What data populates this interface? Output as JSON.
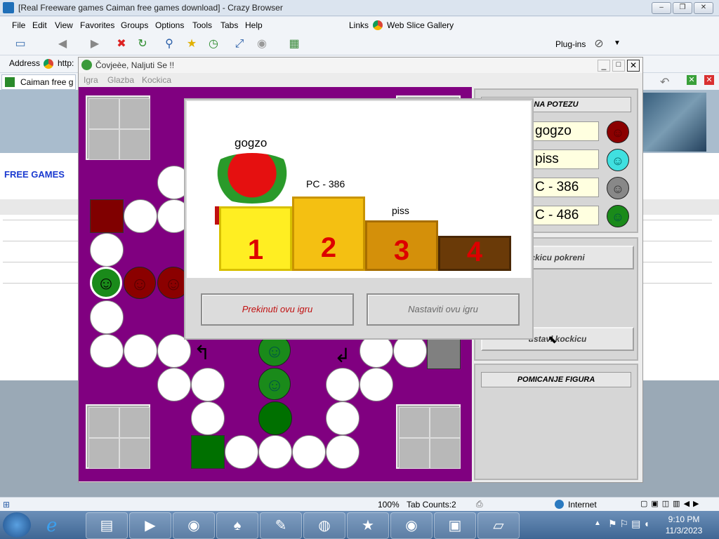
{
  "browser": {
    "title": "[Real Freeware games Caiman free games download] - Crazy Browser",
    "menu": [
      "File",
      "Edit",
      "View",
      "Favorites",
      "Groups",
      "Options",
      "Tools",
      "Tabs",
      "Help"
    ],
    "links_label": "Links",
    "web_slice": "Web Slice Gallery",
    "plugins": "Plug-ins",
    "address_label": "Address",
    "address_value": "http:",
    "tab_label": "Caiman free g",
    "page_nav": "FREE GAMES"
  },
  "status": {
    "zoom": "100%",
    "tab_counts": "Tab Counts:2",
    "zone": "Internet"
  },
  "clock": {
    "time": "9:10 PM",
    "date": "11/3/2023"
  },
  "game": {
    "title": "Čovjeèe, Naljuti Se !!",
    "menu": [
      "Igra",
      "Glazba",
      "Kockica"
    ],
    "panel_title": "NA POTEZU",
    "players": [
      {
        "name": "gogzo",
        "color": "#8b0000"
      },
      {
        "name": "piss",
        "color": "#40e0e0"
      },
      {
        "name": "C - 386",
        "color": "#888888"
      },
      {
        "name": "C - 486",
        "color": "#1a8a1a"
      }
    ],
    "roll_button": "ckicu pokreni",
    "stop_button": "ustavi kockicu",
    "moving_title": "POMICANJE FIGURA"
  },
  "dialog": {
    "podium": [
      {
        "place": "1",
        "name": "gogzo"
      },
      {
        "place": "2",
        "name": "PC - 386"
      },
      {
        "place": "3",
        "name": "piss"
      },
      {
        "place": "4",
        "name": ""
      }
    ],
    "btn_quit": "Prekinuti ovu igru",
    "btn_continue": "Nastaviti ovu igru"
  }
}
